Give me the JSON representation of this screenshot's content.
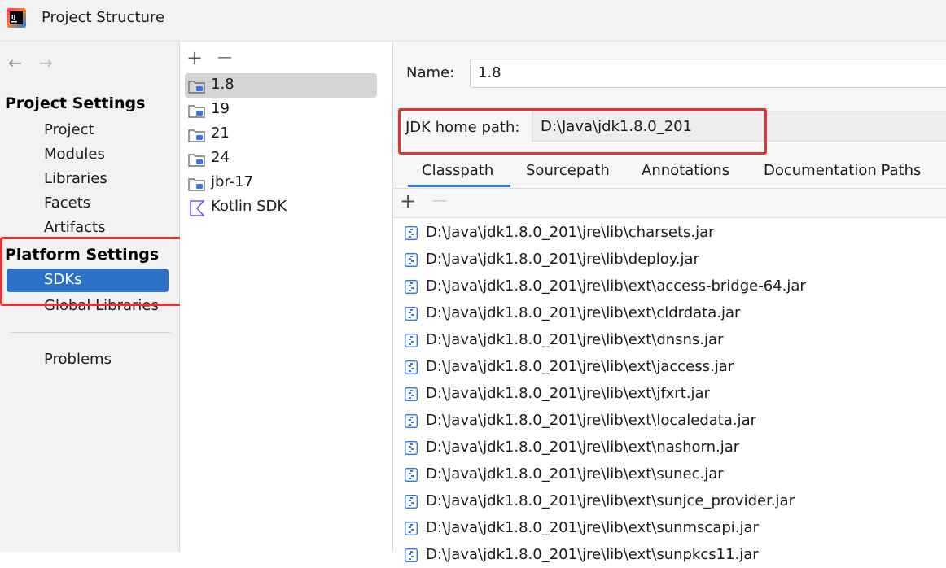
{
  "window": {
    "title": "Project Structure"
  },
  "nav": {
    "back_icon": "arrow-left-icon",
    "forward_icon": "arrow-right-icon",
    "project_settings_header": "Project Settings",
    "project_settings_items": [
      "Project",
      "Modules",
      "Libraries",
      "Facets",
      "Artifacts"
    ],
    "platform_settings_header": "Platform Settings",
    "platform_settings_items": [
      "SDKs",
      "Global Libraries"
    ],
    "selected_item": "SDKs",
    "problems": "Problems"
  },
  "sdk_list": {
    "toolbar": {
      "add": "+",
      "remove": "—"
    },
    "items": [
      {
        "label": "1.8",
        "icon": "jdk-folder-icon",
        "selected": true
      },
      {
        "label": "19",
        "icon": "jdk-folder-icon"
      },
      {
        "label": "21",
        "icon": "jdk-folder-icon"
      },
      {
        "label": "24",
        "icon": "jdk-folder-icon"
      },
      {
        "label": "jbr-17",
        "icon": "jdk-folder-icon"
      },
      {
        "label": "Kotlin SDK",
        "icon": "kotlin-icon"
      }
    ]
  },
  "details": {
    "name_label": "Name:",
    "name_value": "1.8",
    "jdk_home_label": "JDK home path:",
    "jdk_home_value": "D:\\Java\\jdk1.8.0_201",
    "tabs": [
      "Classpath",
      "Sourcepath",
      "Annotations",
      "Documentation Paths"
    ],
    "active_tab": "Classpath",
    "list_toolbar": {
      "add": "+",
      "remove": "—"
    },
    "classpath": [
      "D:\\Java\\jdk1.8.0_201\\jre\\lib\\charsets.jar",
      "D:\\Java\\jdk1.8.0_201\\jre\\lib\\deploy.jar",
      "D:\\Java\\jdk1.8.0_201\\jre\\lib\\ext\\access-bridge-64.jar",
      "D:\\Java\\jdk1.8.0_201\\jre\\lib\\ext\\cldrdata.jar",
      "D:\\Java\\jdk1.8.0_201\\jre\\lib\\ext\\dnsns.jar",
      "D:\\Java\\jdk1.8.0_201\\jre\\lib\\ext\\jaccess.jar",
      "D:\\Java\\jdk1.8.0_201\\jre\\lib\\ext\\jfxrt.jar",
      "D:\\Java\\jdk1.8.0_201\\jre\\lib\\ext\\localedata.jar",
      "D:\\Java\\jdk1.8.0_201\\jre\\lib\\ext\\nashorn.jar",
      "D:\\Java\\jdk1.8.0_201\\jre\\lib\\ext\\sunec.jar",
      "D:\\Java\\jdk1.8.0_201\\jre\\lib\\ext\\sunjce_provider.jar",
      "D:\\Java\\jdk1.8.0_201\\jre\\lib\\ext\\sunmscapi.jar",
      "D:\\Java\\jdk1.8.0_201\\jre\\lib\\ext\\sunpkcs11.jar"
    ]
  },
  "colors": {
    "selection": "#2e72c8",
    "highlight": "#e8322d",
    "tab_underline": "#3574f0"
  }
}
